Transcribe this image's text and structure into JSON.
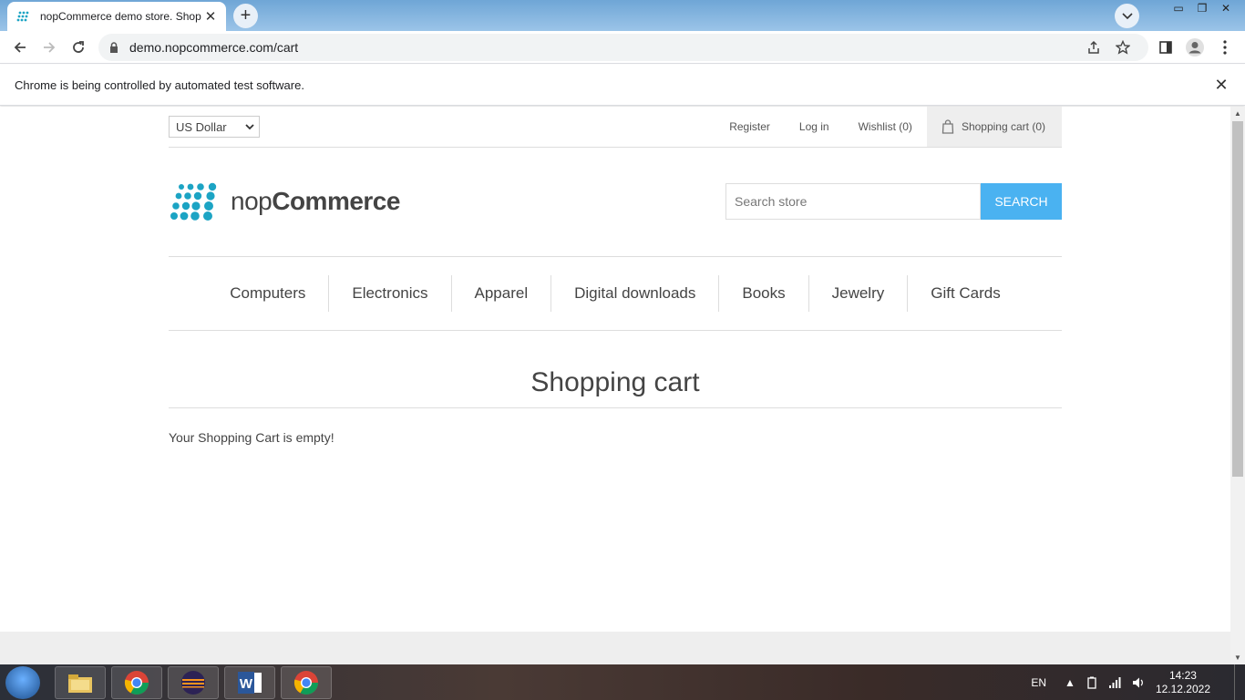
{
  "browser": {
    "tab_title": "nopCommerce demo store. Shop",
    "url": "demo.nopcommerce.com/cart",
    "infobar_text": "Chrome is being controlled by automated test software."
  },
  "header": {
    "currency": "US Dollar",
    "links": {
      "register": "Register",
      "login": "Log in",
      "wishlist": "Wishlist (0)",
      "cart": "Shopping cart (0)"
    },
    "logo_light": "nop",
    "logo_bold": "Commerce",
    "search_placeholder": "Search store",
    "search_button": "SEARCH"
  },
  "menu": [
    "Computers",
    "Electronics",
    "Apparel",
    "Digital downloads",
    "Books",
    "Jewelry",
    "Gift Cards"
  ],
  "page": {
    "title": "Shopping cart",
    "empty_message": "Your Shopping Cart is empty!"
  },
  "taskbar": {
    "language": "EN",
    "time": "14:23",
    "date": "12.12.2022"
  },
  "colors": {
    "accent": "#4ab2f1",
    "logo_dots": "#1ca4c4"
  }
}
